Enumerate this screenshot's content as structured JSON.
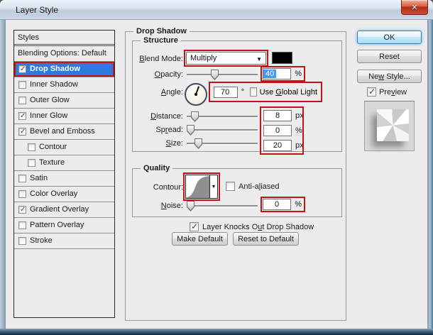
{
  "window": {
    "title": "Layer Style",
    "close_glyph": "✕"
  },
  "sidebar": {
    "header": "Styles",
    "items": [
      {
        "label": "Blending Options: Default",
        "has_checkbox": false,
        "checked": false,
        "selected": false
      },
      {
        "label": "Drop Shadow",
        "has_checkbox": true,
        "checked": true,
        "selected": true
      },
      {
        "label": "Inner Shadow",
        "has_checkbox": true,
        "checked": false,
        "selected": false
      },
      {
        "label": "Outer Glow",
        "has_checkbox": true,
        "checked": false,
        "selected": false
      },
      {
        "label": "Inner Glow",
        "has_checkbox": true,
        "checked": true,
        "selected": false
      },
      {
        "label": "Bevel and Emboss",
        "has_checkbox": true,
        "checked": true,
        "selected": false
      },
      {
        "label": "Contour",
        "has_checkbox": true,
        "checked": false,
        "selected": false,
        "indent": true
      },
      {
        "label": "Texture",
        "has_checkbox": true,
        "checked": false,
        "selected": false,
        "indent": true
      },
      {
        "label": "Satin",
        "has_checkbox": true,
        "checked": false,
        "selected": false
      },
      {
        "label": "Color Overlay",
        "has_checkbox": true,
        "checked": false,
        "selected": false
      },
      {
        "label": "Gradient Overlay",
        "has_checkbox": true,
        "checked": true,
        "selected": false
      },
      {
        "label": "Pattern Overlay",
        "has_checkbox": true,
        "checked": false,
        "selected": false
      },
      {
        "label": "Stroke",
        "has_checkbox": true,
        "checked": false,
        "selected": false
      }
    ]
  },
  "panel": {
    "title": "Drop Shadow",
    "structure": {
      "title": "Structure",
      "blend_mode_label": [
        "",
        "B",
        "lend Mode:"
      ],
      "blend_mode_value": "Multiply",
      "opacity_label": [
        "",
        "O",
        "pacity:"
      ],
      "opacity_value": "40",
      "opacity_unit": "%",
      "angle_label": [
        "",
        "A",
        "ngle:"
      ],
      "angle_value": "70",
      "angle_unit": "°",
      "global_light_label": [
        "Use ",
        "G",
        "lobal Light"
      ],
      "global_light_checked": false,
      "distance_label": [
        "",
        "D",
        "istance:"
      ],
      "distance_value": "8",
      "distance_unit": "px",
      "spread_label": [
        "Sp",
        "r",
        "ead:"
      ],
      "spread_value": "0",
      "spread_unit": "%",
      "size_label": [
        "",
        "S",
        "ize:"
      ],
      "size_value": "20",
      "size_unit": "px"
    },
    "quality": {
      "title": "Quality",
      "contour_label": [
        "Contour:",
        "",
        ""
      ],
      "anti_aliased_label": [
        "Anti-a",
        "l",
        "iased"
      ],
      "anti_aliased_checked": false,
      "noise_label": [
        "",
        "N",
        "oise:"
      ],
      "noise_value": "0",
      "noise_unit": "%"
    },
    "knockout_label": [
      "Layer Knocks O",
      "u",
      "t Drop Shadow"
    ],
    "knockout_checked": true,
    "make_default_label": "Make Default",
    "reset_to_default_label": "Reset to Default"
  },
  "actions": {
    "ok_label": "OK",
    "reset_label": "Reset",
    "new_style_label": [
      "Ne",
      "w",
      " Style..."
    ],
    "preview_label": [
      "Pre",
      "v",
      "iew"
    ],
    "preview_checked": true
  },
  "colors": {
    "annotation": "#c21414",
    "selection_bg": "#2b7be0",
    "value_selection": "#3d9bfd",
    "blend_swatch": "#000000"
  }
}
